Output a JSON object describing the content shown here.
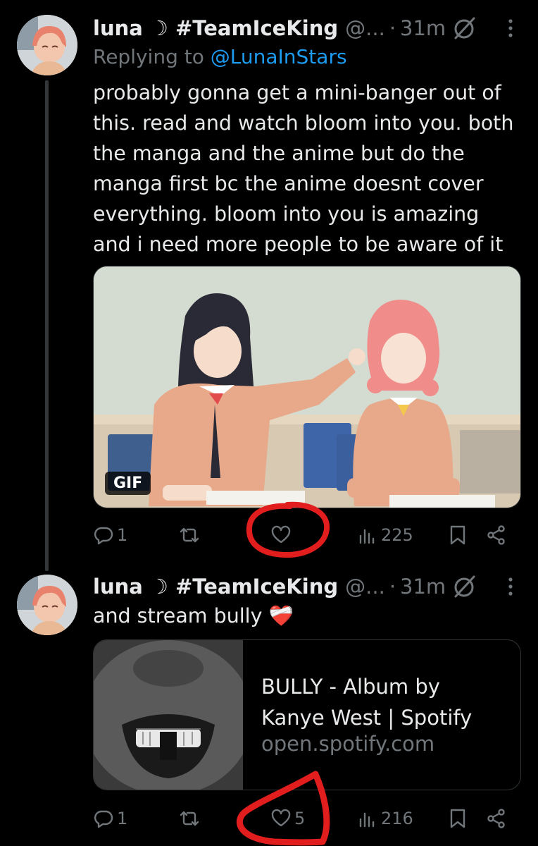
{
  "tweets": [
    {
      "author": {
        "name": "luna ☽ #TeamIceKing",
        "handle": "@...",
        "time": "31m"
      },
      "replying": {
        "prefix": "Replying to ",
        "mention": "@LunaInStars"
      },
      "text": "probably gonna get a mini-banger out of this. read and watch bloom into you. both the manga and the anime but do the manga first bc the anime doesnt cover everything. bloom into you is amazing and i need more people to be aware of it",
      "media": {
        "type": "gif",
        "badge": "GIF"
      },
      "actions": {
        "replies": "1",
        "reposts": "",
        "likes": "",
        "views": "225"
      }
    },
    {
      "author": {
        "name": "luna ☽ #TeamIceKing",
        "handle": "@...",
        "time": "31m"
      },
      "text": "and stream bully ❤️‍🩹",
      "card": {
        "title": "BULLY - Album by Kanye West | Spotify",
        "domain": "open.spotify.com"
      },
      "actions": {
        "replies": "1",
        "reposts": "",
        "likes": "5",
        "views": "216"
      }
    }
  ],
  "annotations": {
    "circle_color": "#e11d1d"
  },
  "icons": [
    "grok-icon",
    "more-icon",
    "reply-icon",
    "repost-icon",
    "like-icon",
    "views-icon",
    "bookmark-icon",
    "share-icon"
  ]
}
